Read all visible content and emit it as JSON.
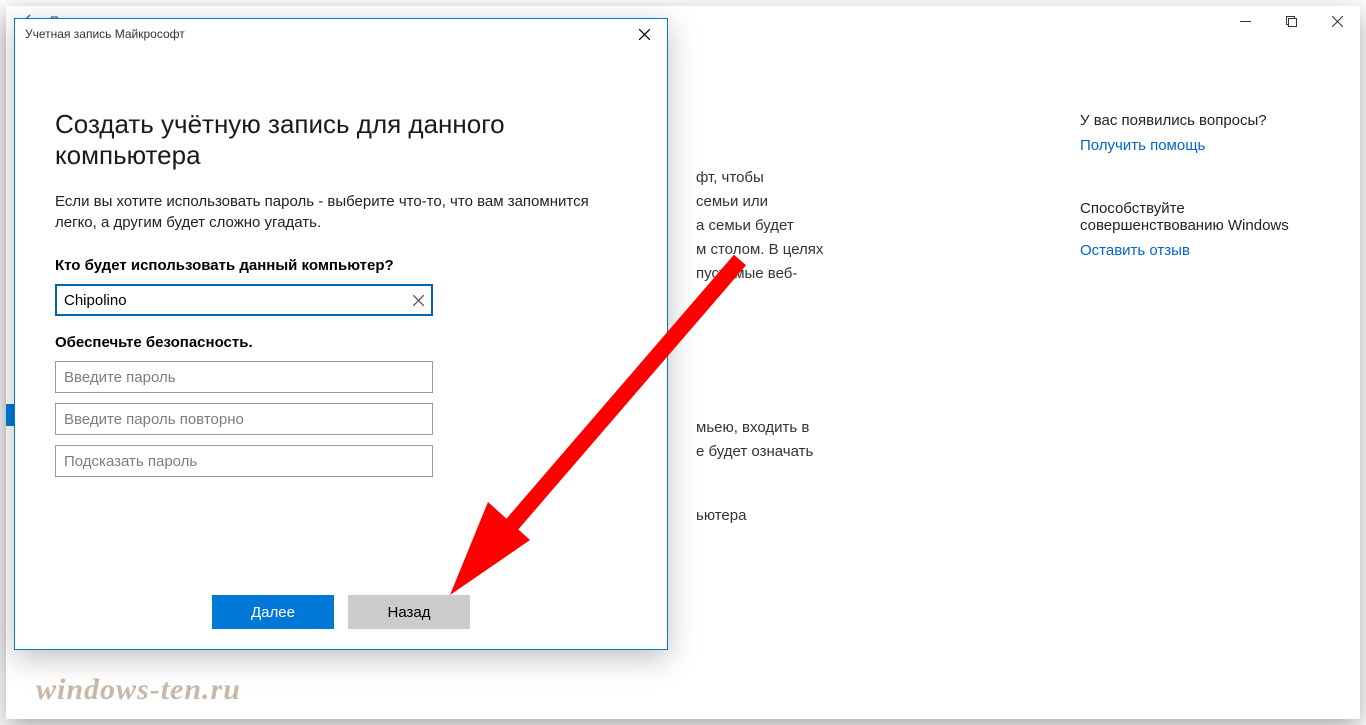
{
  "parent": {
    "title": "Параметры",
    "bg_lines": [
      "фт, чтобы",
      "семьи или",
      "а семьи будет",
      "м столом. В целях",
      "пустимые веб-"
    ],
    "bg_lines2": [
      "мьею, входить в",
      "е будет означать"
    ],
    "bg_line3": "ьютера"
  },
  "sidebar": {
    "q_label": "У вас появились вопросы?",
    "help_link": "Получить помощь",
    "improve_label1": "Способствуйте",
    "improve_label2": "совершенствованию Windows",
    "feedback_link": "Оставить отзыв"
  },
  "dialog": {
    "title": "Учетная запись Майкрософт",
    "heading": "Создать учётную запись для данного компьютера",
    "description": "Если вы хотите использовать пароль - выберите что-то, что вам запомнится легко, а другим будет сложно угадать.",
    "who_label": "Кто будет использовать данный компьютер?",
    "username_value": "Chipolino",
    "secure_label": "Обеспечьте безопасность.",
    "password_placeholder": "Введите пароль",
    "password_confirm_placeholder": "Введите пароль повторно",
    "password_hint_placeholder": "Подсказать пароль",
    "next_btn": "Далее",
    "back_btn": "Назад"
  },
  "watermark": "windows-ten.ru"
}
